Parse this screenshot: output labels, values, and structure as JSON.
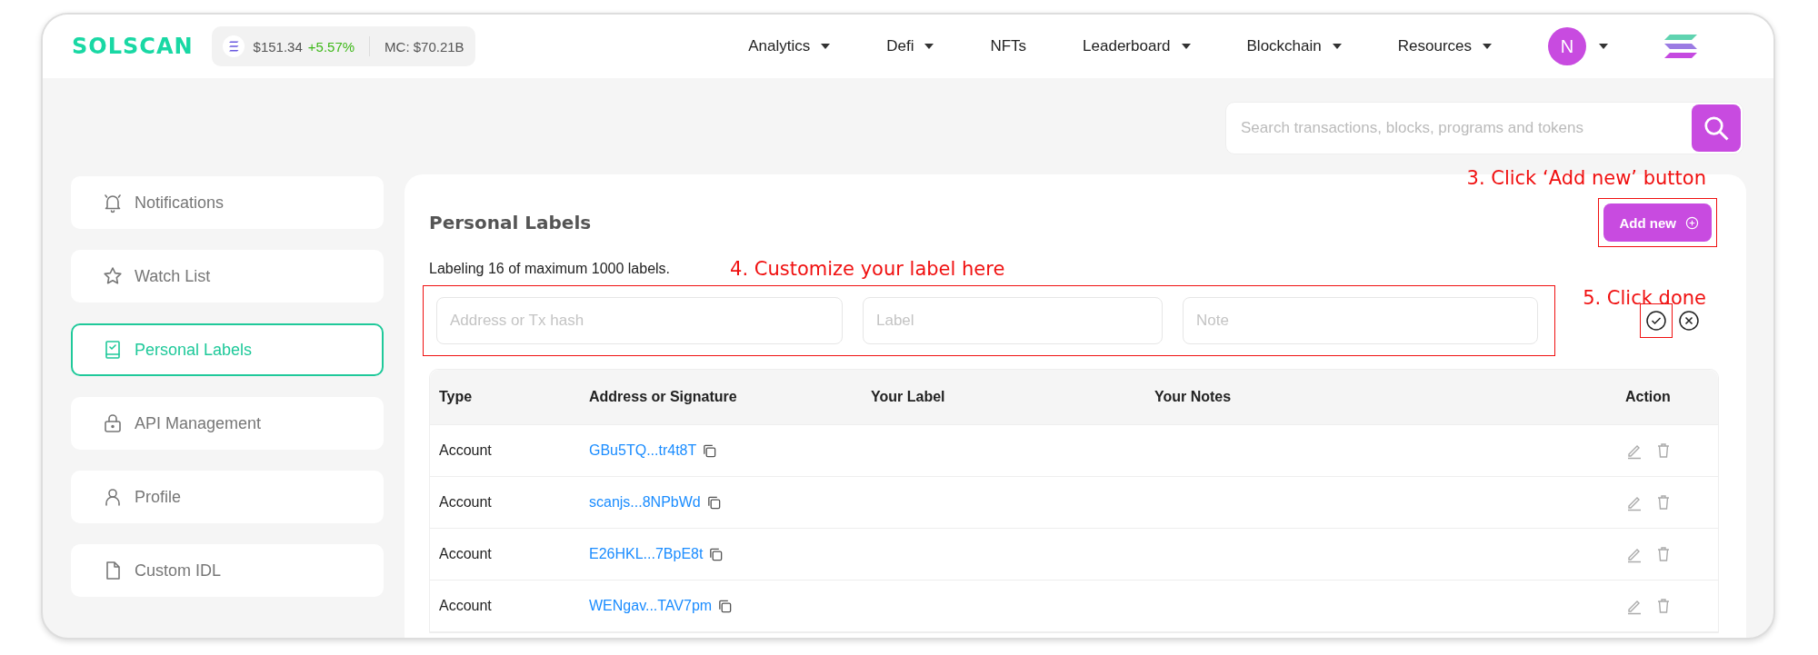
{
  "header": {
    "logo": "SOLSCAN",
    "price": "$151.34",
    "change": "+5.57%",
    "market_cap": "MC: $70.21B",
    "nav": [
      {
        "label": "Analytics",
        "dropdown": true
      },
      {
        "label": "Defi",
        "dropdown": true
      },
      {
        "label": "NFTs",
        "dropdown": false
      },
      {
        "label": "Leaderboard",
        "dropdown": true
      },
      {
        "label": "Blockchain",
        "dropdown": true
      },
      {
        "label": "Resources",
        "dropdown": true
      }
    ],
    "avatar": "N"
  },
  "search": {
    "placeholder": "Search transactions, blocks, programs and tokens"
  },
  "sidebar": {
    "items": [
      {
        "label": "Notifications",
        "kind": "bell",
        "selected": false
      },
      {
        "label": "Watch List",
        "kind": "star",
        "selected": false
      },
      {
        "label": "Personal Labels",
        "kind": "book",
        "selected": true
      },
      {
        "label": "API Management",
        "kind": "lock",
        "selected": false
      },
      {
        "label": "Profile",
        "kind": "person",
        "selected": false
      },
      {
        "label": "Custom IDL",
        "kind": "file",
        "selected": false
      }
    ]
  },
  "panel": {
    "title": "Personal Labels",
    "add_button": "Add new",
    "summary": "Labeling 16 of maximum 1000 labels.",
    "form": {
      "fields": [
        {
          "placeholder": "Address or Tx hash"
        },
        {
          "placeholder": "Label"
        },
        {
          "placeholder": "Note"
        }
      ]
    },
    "table": {
      "columns": [
        "Type",
        "Address or Signature",
        "Your Label",
        "Your Notes",
        "Action"
      ],
      "rows": [
        {
          "type": "Account",
          "address": "GBu5TQ...tr4t8T"
        },
        {
          "type": "Account",
          "address": "scanjs...8NPbWd"
        },
        {
          "type": "Account",
          "address": "E26HKL...7BpE8t"
        },
        {
          "type": "Account",
          "address": "WENgav...TAV7pm"
        }
      ]
    }
  },
  "annotations": [
    "3. Click ‘Add new’ button",
    "4. Customize your label here",
    "5. Click done"
  ]
}
